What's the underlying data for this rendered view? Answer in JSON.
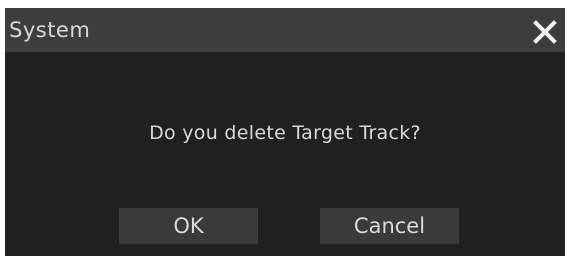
{
  "dialog": {
    "title": "System",
    "close_icon": "close-icon",
    "message": "Do you delete Target Track?",
    "ok_label": "OK",
    "cancel_label": "Cancel"
  },
  "colors": {
    "dialog_background": "#202020",
    "titlebar_background": "#3d3d3d",
    "button_background": "#3a3a3a",
    "text": "#d8d8d8"
  }
}
